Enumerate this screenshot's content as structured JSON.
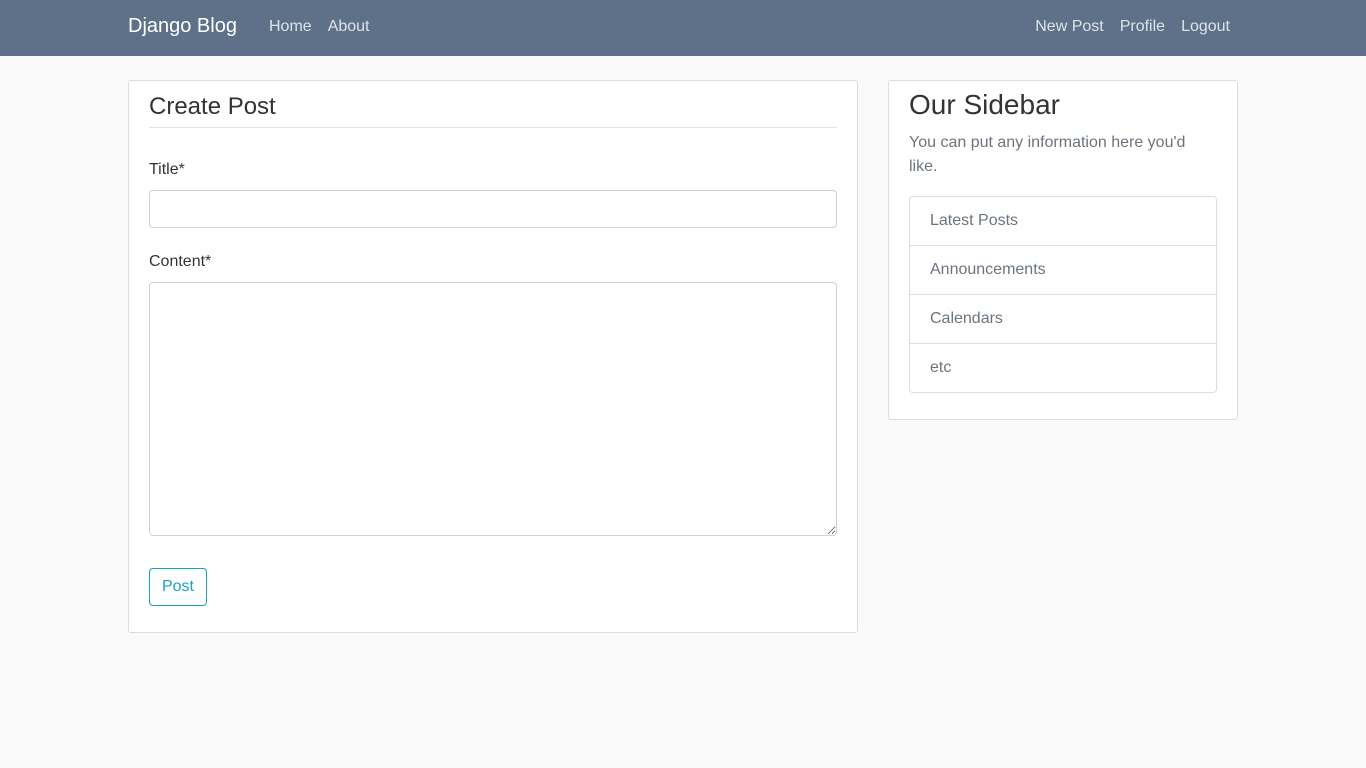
{
  "navbar": {
    "brand": "Django Blog",
    "left_links": [
      "Home",
      "About"
    ],
    "right_links": [
      "New Post",
      "Profile",
      "Logout"
    ],
    "background_color": "#5f7189"
  },
  "form": {
    "legend": "Create Post",
    "title_label": "Title*",
    "title_value": "",
    "content_label": "Content*",
    "content_value": "",
    "submit_label": "Post",
    "accent_color": "#17a2b8"
  },
  "sidebar": {
    "title": "Our Sidebar",
    "description": "You can put any information here you'd like.",
    "items": [
      "Latest Posts",
      "Announcements",
      "Calendars",
      "etc"
    ]
  }
}
